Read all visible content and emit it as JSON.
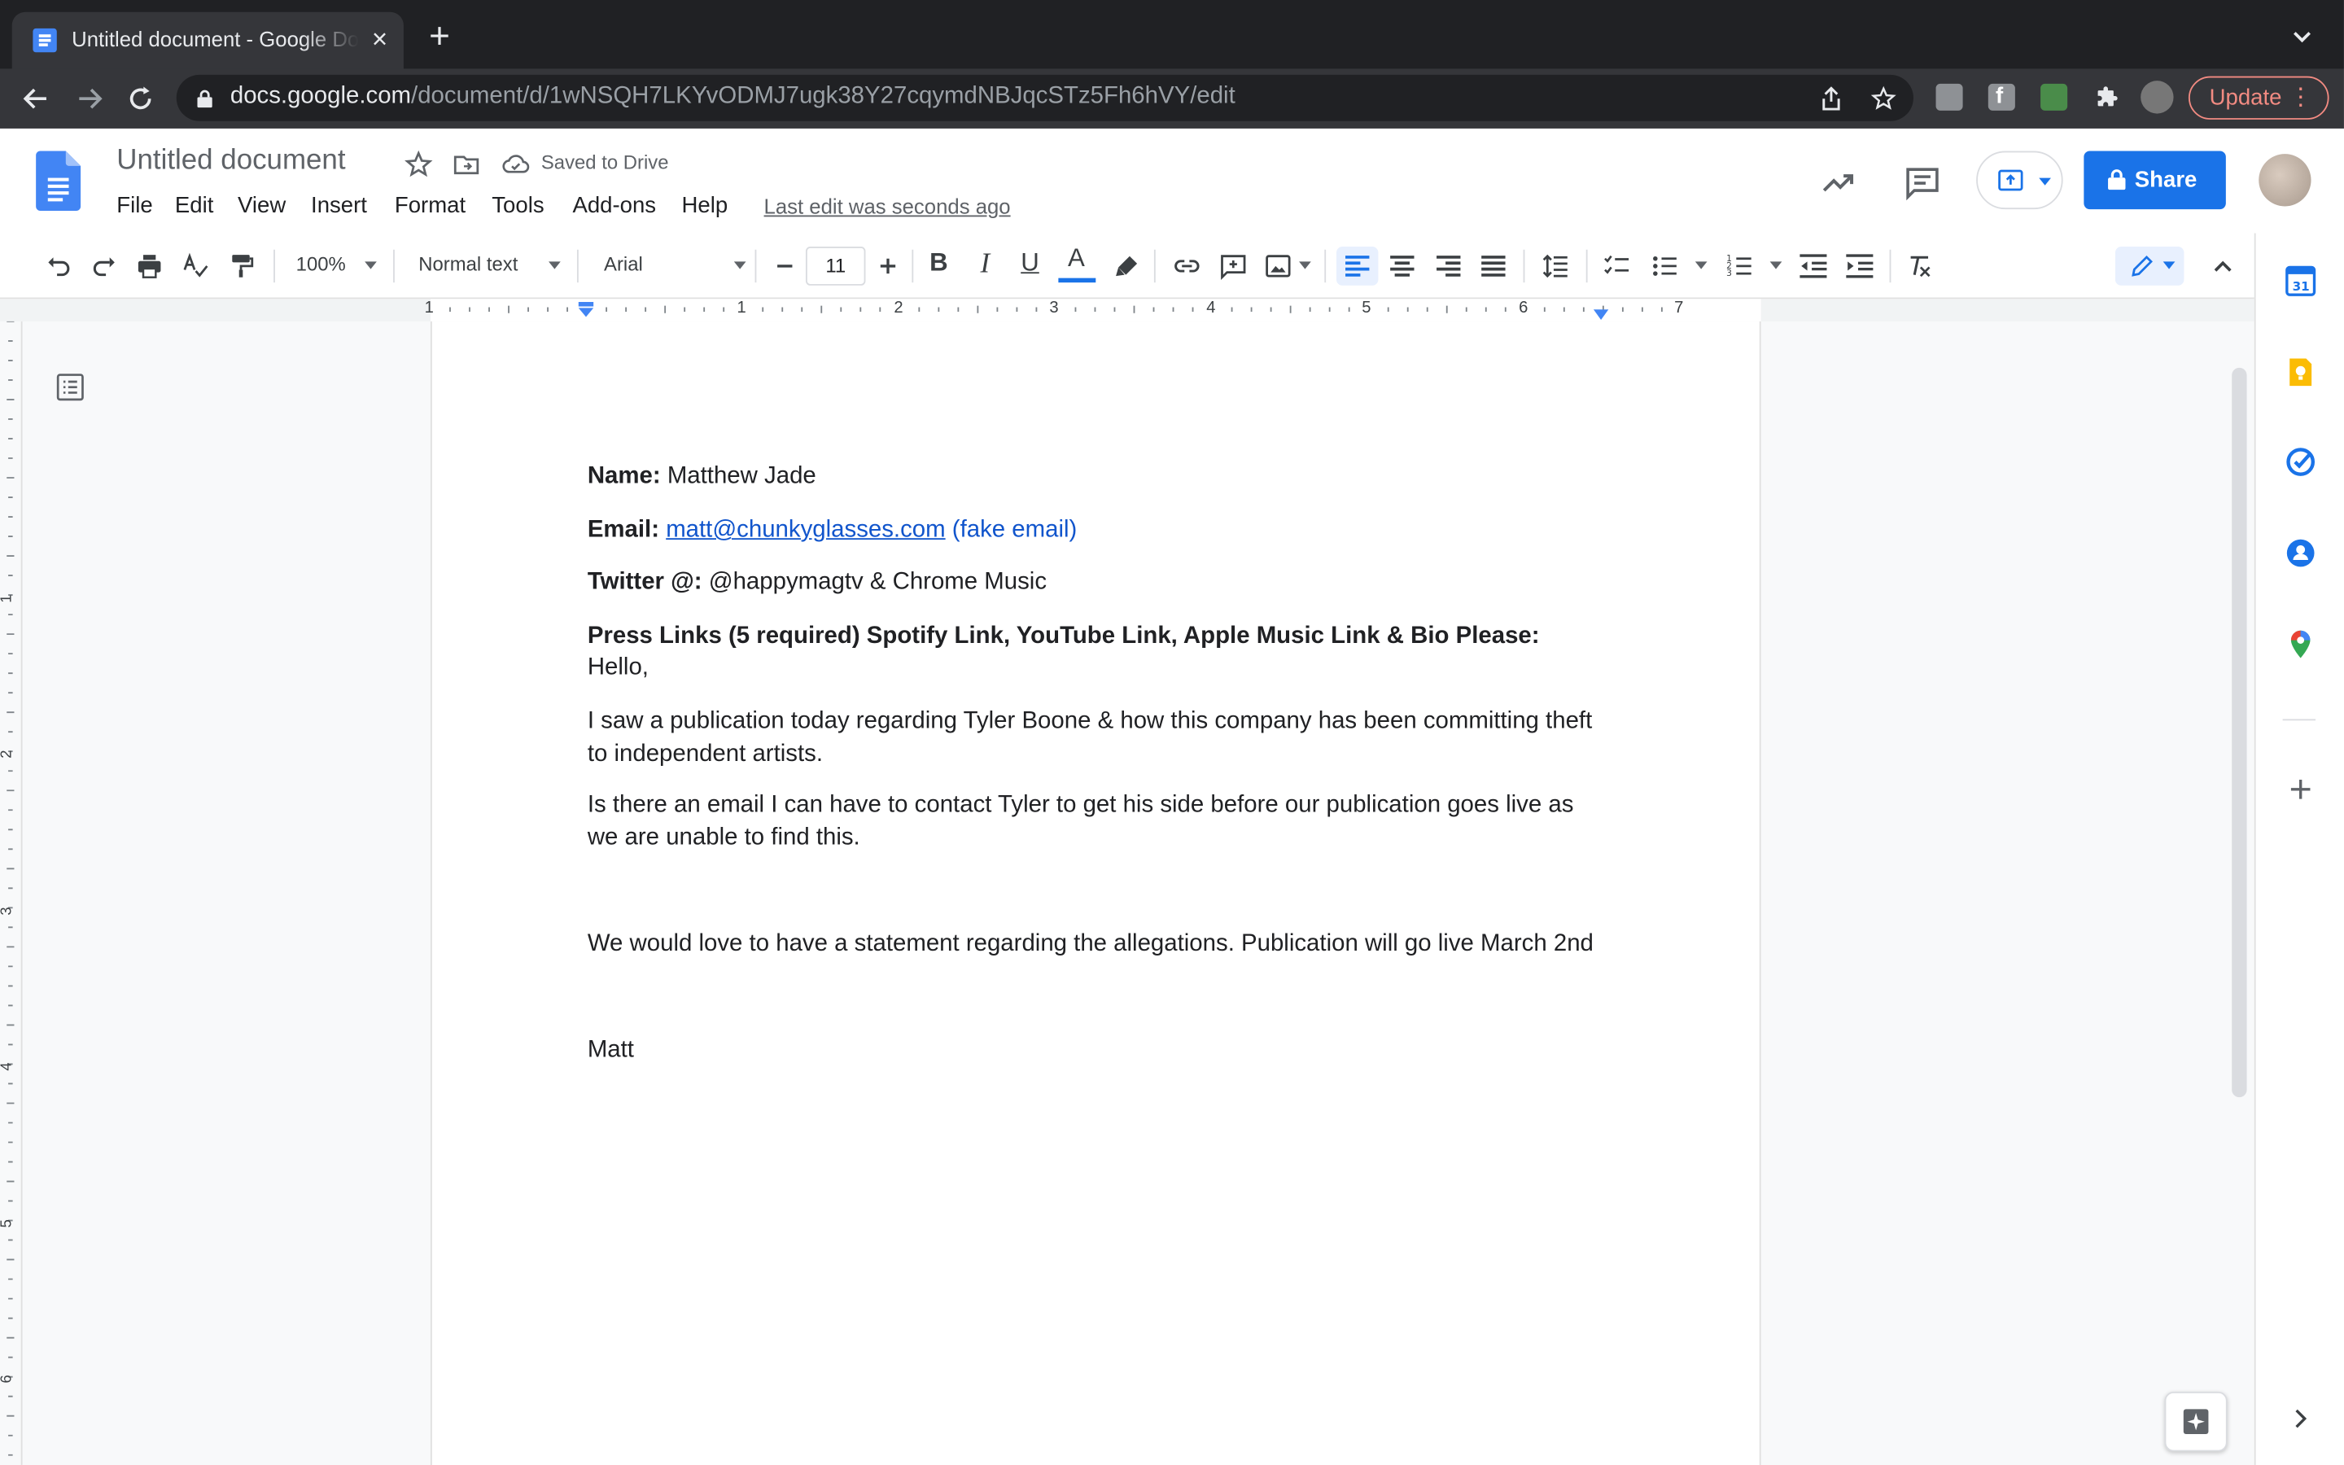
{
  "browser": {
    "tab_title": "Untitled document - Google Docs",
    "url_host": "docs.google.com",
    "url_path": "/document/d/1wNSQH7LKYvODMJ7ugk38Y27cqymdNBJqcSTz5Fh6hVY/edit",
    "update_label": "Update"
  },
  "docs": {
    "title": "Untitled document",
    "saved_status": "Saved to Drive",
    "menu": [
      "File",
      "Edit",
      "View",
      "Insert",
      "Format",
      "Tools",
      "Add-ons",
      "Help"
    ],
    "last_edit": "Last edit was seconds ago",
    "share_label": "Share"
  },
  "toolbar": {
    "zoom": "100%",
    "style": "Normal text",
    "font": "Arial",
    "font_size": "11",
    "bold": "B",
    "italic": "I",
    "underline": "U",
    "text_color": "A"
  },
  "ruler": {
    "numbers": [
      "1",
      "1",
      "2",
      "3",
      "4",
      "5",
      "6",
      "7"
    ],
    "vertical_numbers": [
      "1",
      "2",
      "3",
      "4",
      "5",
      "6"
    ]
  },
  "document": {
    "name_label": "Name:",
    "name_value": " Matthew Jade",
    "email_label": "Email:",
    "email_link": "matt@chunkyglasses.com",
    "email_note": " (fake email)",
    "twitter_label": "Twitter @:",
    "twitter_value": " @happymagtv & Chrome Music",
    "press_links": "Press Links (5 required) Spotify Link, YouTube Link, Apple Music Link & Bio Please:",
    "greeting": "Hello,",
    "para1": "I saw a publication today regarding Tyler Boone & how this company has been committing theft to independent artists.",
    "para2": "Is there an email I can have to contact Tyler to get his side before our publication goes live as we are unable to find this.",
    "para3": "We would love to have a statement regarding the allegations. Publication will go live March 2nd",
    "signature": "Matt"
  },
  "colors": {
    "docs_blue": "#4285f4",
    "share_blue": "#1a73e8",
    "link_blue": "#1155cc",
    "update_red": "#f28b82",
    "calendar_blue": "#1a73e8",
    "keep_yellow": "#fbbc04"
  }
}
